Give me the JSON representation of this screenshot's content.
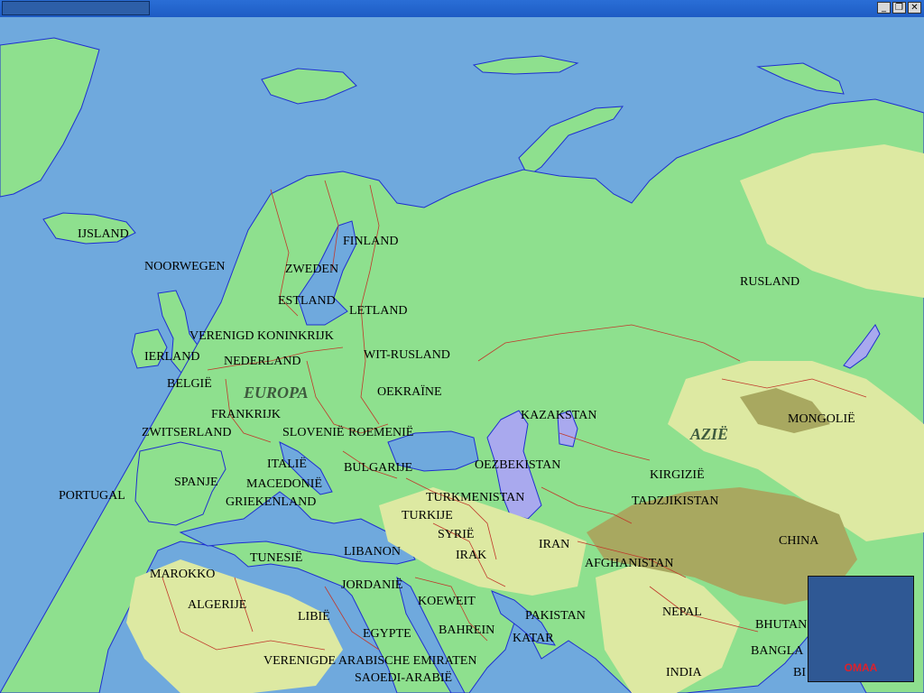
{
  "window": {
    "minimize_icon": "minimize-icon",
    "restore_icon": "restore-icon",
    "close_icon": "close-icon"
  },
  "map": {
    "colors": {
      "sea": "#6fa9dd",
      "lowland": "#8ee08e",
      "highland": "#dde9a2",
      "mountain": "#a8a860",
      "border": "#c0392b",
      "lake": "#a9a9ee"
    },
    "continents": {
      "europe": "EUROPA",
      "asia": "AZIË"
    },
    "countries": {
      "ijsland": "IJSLAND",
      "noorwegen": "NOORWEGEN",
      "zweden": "ZWEDEN",
      "finland": "FINLAND",
      "estland": "ESTLAND",
      "letland": "LETLAND",
      "verenigd_koninkrijk": "VERENIGD KONINKRIJK",
      "ierland": "IERLAND",
      "nederland": "NEDERLAND",
      "wit_rusland": "WIT-RUSLAND",
      "belgie": "BELGIË",
      "oekraine": "OEKRAÏNE",
      "frankrijk": "FRANKRIJK",
      "zwitserland": "ZWITSERLAND",
      "slovenie": "SLOVENIË",
      "roemenie": "ROEMENIË",
      "italie": "ITALIË",
      "bulgarije": "BULGARIJE",
      "spanje": "SPANJE",
      "macedonie": "MACEDONIË",
      "portugal": "PORTUGAL",
      "griekenland": "GRIEKENLAND",
      "turkmenistan": "TURKMENISTAN",
      "turkije": "TURKIJE",
      "syrie": "SYRIË",
      "tunesie": "TUNESIË",
      "libanon": "LIBANON",
      "irak": "IRAK",
      "iran": "IRAN",
      "marokko": "MAROKKO",
      "jordanie": "JORDANIË",
      "algerije": "ALGERIJE",
      "koeweit": "KOEWEIT",
      "libie": "LIBIË",
      "egypte": "EGYPTE",
      "bahrein": "BAHREIN",
      "pakistan": "PAKISTAN",
      "katar": "KATAR",
      "verenigde_arabische_emiraten": "VERENIGDE ARABISCHE EMIRATEN",
      "saoedi_arabie": "SAOEDI-ARABIË",
      "rusland": "RUSLAND",
      "kazakstan": "KAZAKSTAN",
      "oezbekistan": "OEZBEKISTAN",
      "kirgizie": "KIRGIZIË",
      "tadzjikistan": "TADZJIKISTAN",
      "afghanistan": "AFGHANISTAN",
      "mongolie": "MONGOLIË",
      "china": "CHINA",
      "nepal": "NEPAL",
      "bhutan": "BHUTAN",
      "bangladesh": "BANGLA",
      "india": "INDIA",
      "birma": "BI"
    }
  },
  "back_button": {
    "label": "OMAA"
  }
}
